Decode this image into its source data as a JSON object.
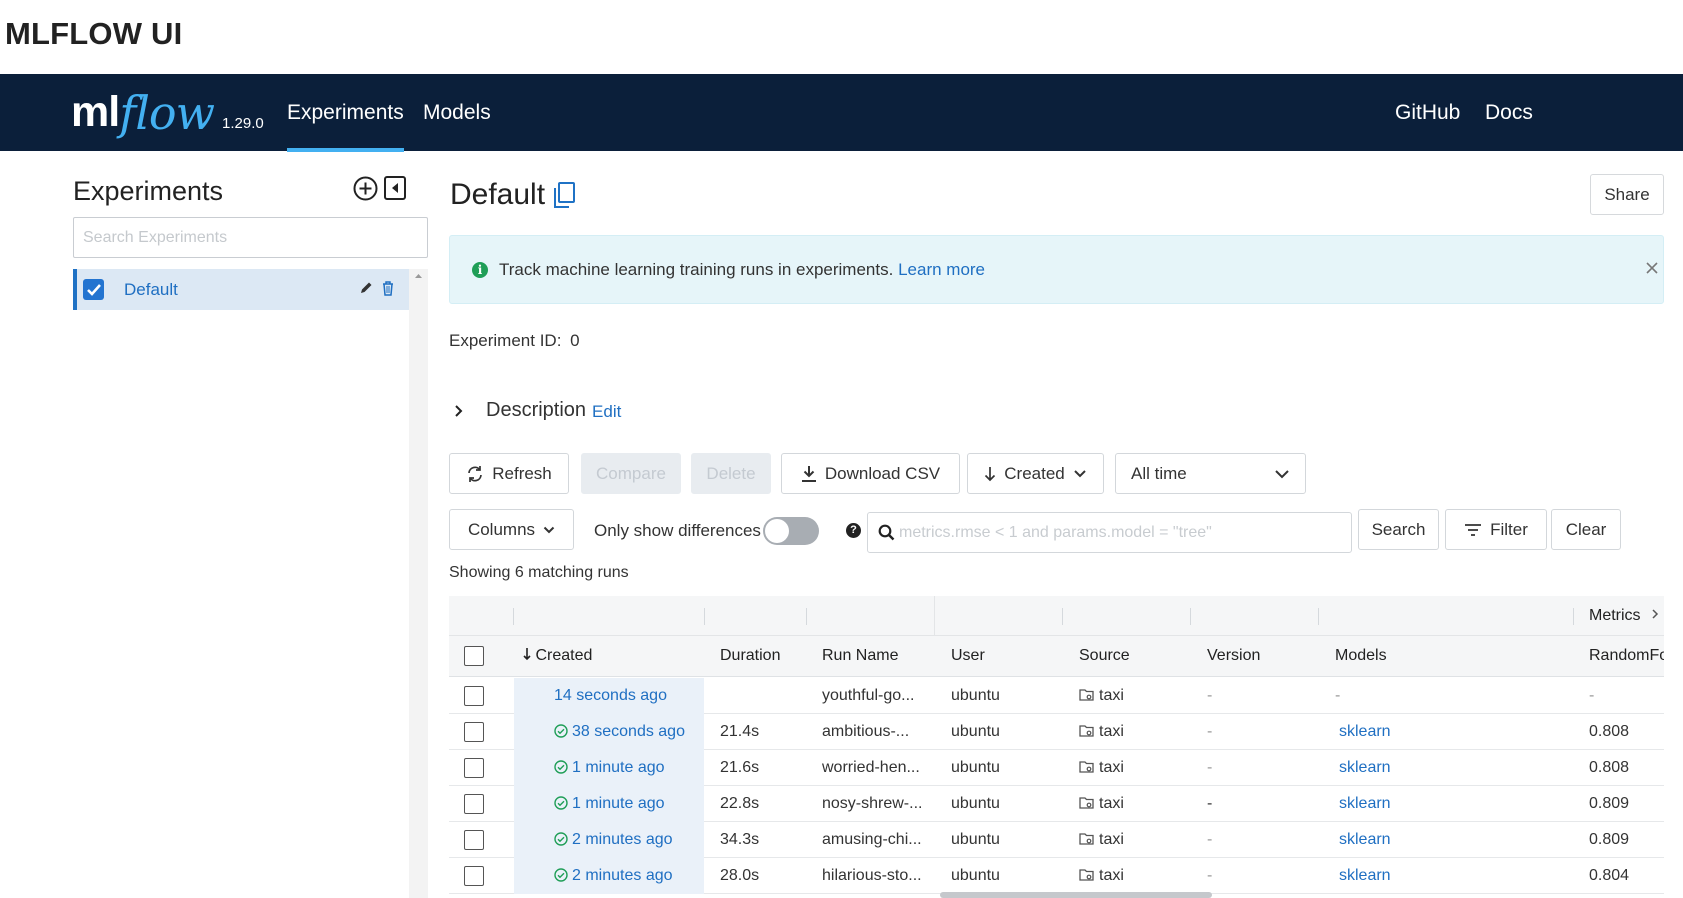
{
  "page_heading": "MLFLOW UI",
  "navbar": {
    "logo_text": "mlflow",
    "logo_ml": "ml",
    "logo_flow": "flow",
    "version": "1.29.0",
    "links": {
      "experiments": "Experiments",
      "models": "Models",
      "github": "GitHub",
      "docs": "Docs"
    },
    "colors": {
      "background": "#0b1f3a",
      "accent": "#43b0f1"
    }
  },
  "sidebar": {
    "title": "Experiments",
    "search_placeholder": "Search Experiments",
    "icons": [
      "add-circle-icon",
      "collapse-sidebar-icon"
    ],
    "experiments": [
      {
        "name": "Default",
        "checked": true
      }
    ]
  },
  "main": {
    "title": "Default",
    "share_label": "Share",
    "banner": {
      "text": "Track machine learning training runs in experiments.",
      "link": "Learn more"
    },
    "experiment_id_label": "Experiment ID:",
    "experiment_id": "0",
    "description_label": "Description",
    "description_edit": "Edit",
    "toolbar": {
      "refresh": "Refresh",
      "compare": "Compare",
      "delete": "Delete",
      "download_csv": "Download CSV",
      "sort": "Created",
      "time_range": "All time",
      "columns": "Columns",
      "only_show_differences": "Only show differences",
      "only_show_differences_on": false,
      "search_placeholder": "metrics.rmse < 1 and params.model = \"tree\"",
      "search": "Search",
      "filter": "Filter",
      "clear": "Clear"
    },
    "showing_text": "Showing 6 matching runs",
    "table": {
      "group_header": "Metrics",
      "columns": [
        "Created",
        "Duration",
        "Run Name",
        "User",
        "Source",
        "Version",
        "Models",
        "RandomFo"
      ],
      "rows": [
        {
          "created": "14 seconds ago",
          "status": "running",
          "duration": "",
          "run_name": "youthful-go...",
          "user": "ubuntu",
          "source": "taxi",
          "version": "-",
          "models": "-",
          "metric": "-"
        },
        {
          "created": "38 seconds ago",
          "status": "finished",
          "duration": "21.4s",
          "run_name": "ambitious-...",
          "user": "ubuntu",
          "source": "taxi",
          "version": "-",
          "models": "sklearn",
          "metric": "0.808"
        },
        {
          "created": "1 minute ago",
          "status": "finished",
          "duration": "21.6s",
          "run_name": "worried-hen...",
          "user": "ubuntu",
          "source": "taxi",
          "version": "-",
          "models": "sklearn",
          "metric": "0.808"
        },
        {
          "created": "1 minute ago",
          "status": "finished",
          "duration": "22.8s",
          "run_name": "nosy-shrew-...",
          "user": "ubuntu",
          "source": "taxi",
          "version": "-",
          "models": "sklearn",
          "metric": "0.809"
        },
        {
          "created": "2 minutes ago",
          "status": "finished",
          "duration": "34.3s",
          "run_name": "amusing-chi...",
          "user": "ubuntu",
          "source": "taxi",
          "version": "-",
          "models": "sklearn",
          "metric": "0.809"
        },
        {
          "created": "2 minutes ago",
          "status": "finished",
          "duration": "28.0s",
          "run_name": "hilarious-sto...",
          "user": "ubuntu",
          "source": "taxi",
          "version": "-",
          "models": "sklearn",
          "metric": "0.804"
        }
      ]
    }
  }
}
